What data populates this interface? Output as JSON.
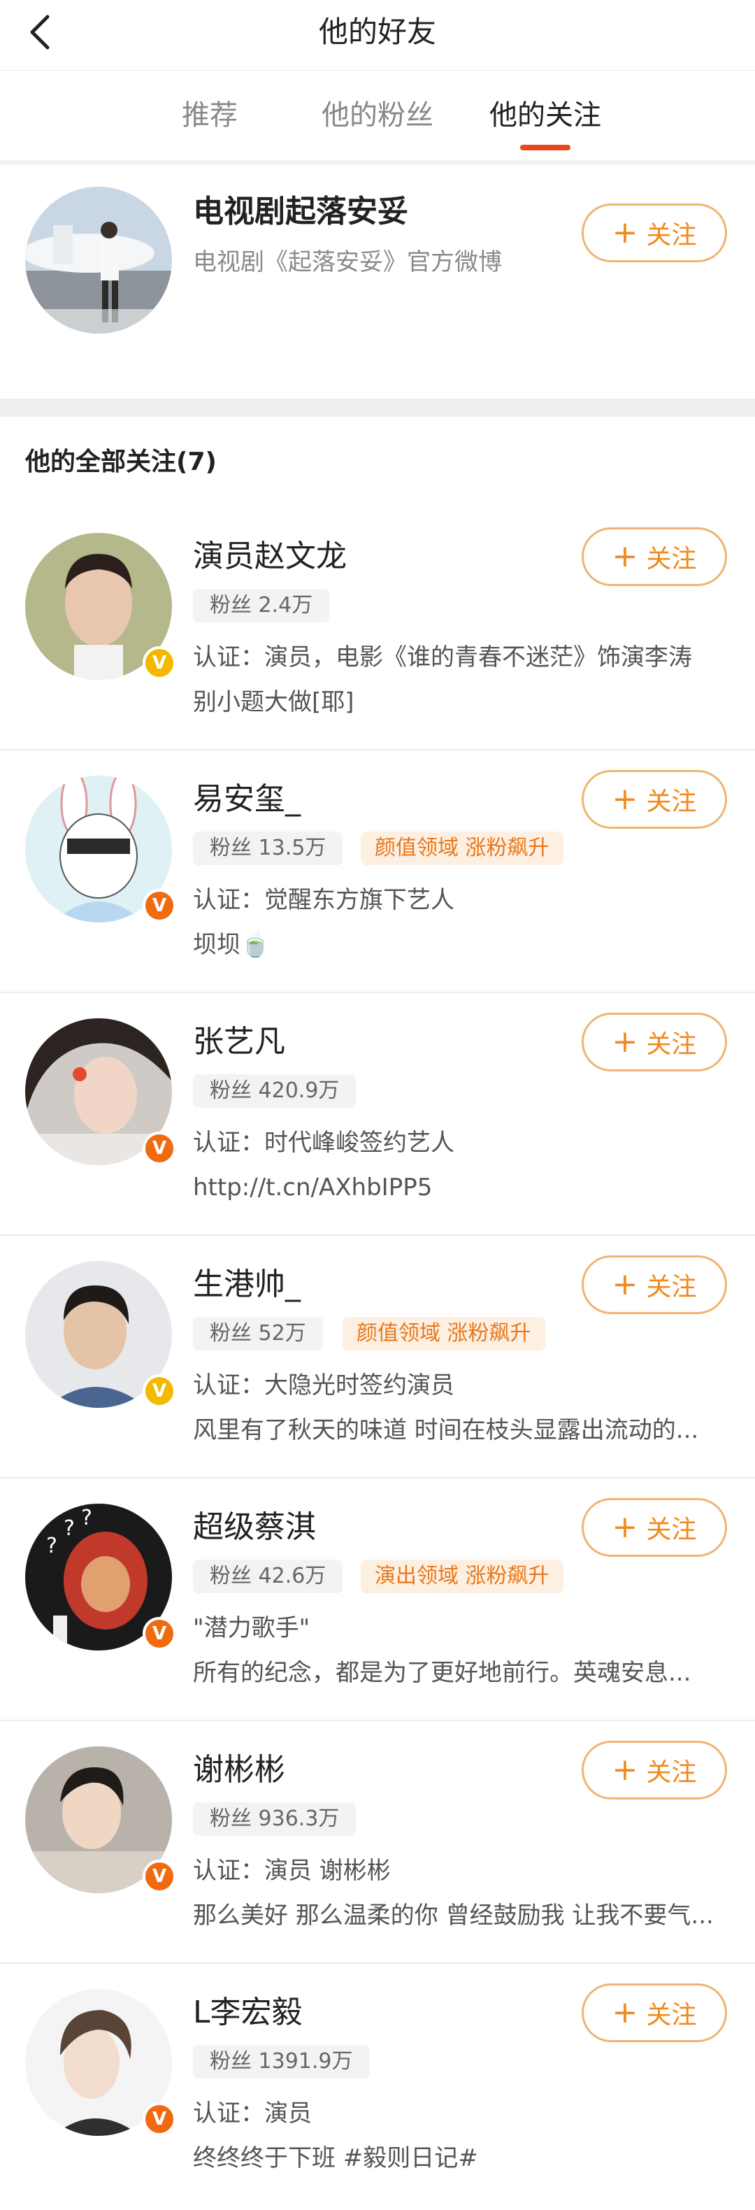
{
  "header": {
    "title": "他的好友"
  },
  "tabs": [
    {
      "label": "推荐",
      "active": false
    },
    {
      "label": "他的粉丝",
      "active": false
    },
    {
      "label": "他的关注",
      "active": true
    }
  ],
  "featured": {
    "name": "电视剧起落安妥",
    "desc": "电视剧《起落安妥》官方微博",
    "follow_label": "关注",
    "avatar_icon": "airplane-pilot-photo"
  },
  "section_title": "他的全部关注(7)",
  "follow_label": "关注",
  "colors": {
    "accent": "#e9481b",
    "follow_text": "#f08a1c",
    "follow_border": "#f0b472",
    "tag_text": "#e8771a",
    "tag_bg": "#fdf0e3",
    "badge_gold": "#f5b800",
    "badge_orange": "#f06a10"
  },
  "users": [
    {
      "name": "演员赵文龙",
      "fans": "粉丝 2.4万",
      "tag": "",
      "line1": "认证：演员，电影《谁的青春不迷茫》饰演李涛",
      "line2": "别小题大做[耶]",
      "badge": "gold",
      "badge_glyph": "V"
    },
    {
      "name": "易安玺_",
      "fans": "粉丝 13.5万",
      "tag": "颜值领域 涨粉飙升",
      "line1": "认证：觉醒东方旗下艺人",
      "line2": "坝坝🍵",
      "badge": "orange",
      "badge_glyph": "V"
    },
    {
      "name": "张艺凡",
      "fans": "粉丝 420.9万",
      "tag": "",
      "line1": "认证：时代峰峻签约艺人",
      "line2": "http://t.cn/AXhbIPP5",
      "badge": "orange",
      "badge_glyph": "V"
    },
    {
      "name": "生港帅_",
      "fans": "粉丝 52万",
      "tag": "颜值领域 涨粉飙升",
      "line1": "认证：大隐光时签约演员",
      "line2": "风里有了秋天的味道 时间在枝头显露出流动的...",
      "badge": "gold",
      "badge_glyph": "V"
    },
    {
      "name": "超级蔡淇",
      "fans": "粉丝 42.6万",
      "tag": "演出领域 涨粉飙升",
      "line1": "\"潜力歌手\"",
      "line2": "所有的纪念，都是为了更好地前行。英魂安息...",
      "badge": "orange",
      "badge_glyph": "V"
    },
    {
      "name": "谢彬彬",
      "fans": "粉丝 936.3万",
      "tag": "",
      "line1": "认证：演员 谢彬彬",
      "line2": "那么美好 那么温柔的你 曾经鼓励我 让我不要气...",
      "badge": "orange",
      "badge_glyph": "V"
    },
    {
      "name": "L李宏毅",
      "fans": "粉丝 1391.9万",
      "tag": "",
      "line1": "认证：演员",
      "line2": "终终终于下班 #毅则日记#",
      "badge": "orange",
      "badge_glyph": "V"
    }
  ]
}
